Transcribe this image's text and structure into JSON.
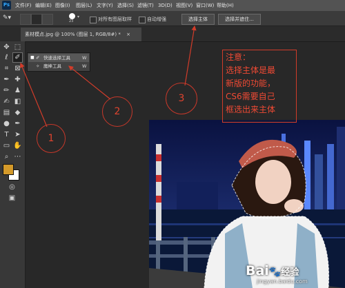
{
  "menu": {
    "logo": "Ps",
    "items": [
      "文件(F)",
      "编辑(E)",
      "图像(I)",
      "图层(L)",
      "文字(Y)",
      "选择(S)",
      "滤镜(T)",
      "3D(D)",
      "视图(V)",
      "窗口(W)",
      "帮助(H)"
    ]
  },
  "options": {
    "brush_size": "23",
    "sample_all_layers": "对所有图层取样",
    "auto_enhance": "自动增强",
    "select_subject": "选择主体",
    "select_and_mask": "选择并遮住..."
  },
  "document": {
    "tab_title": "素材模点.jpg @ 100% (图层 1, RGB/8#) *",
    "close": "×"
  },
  "flyout": {
    "items": [
      {
        "label": "快速选择工具",
        "shortcut": "W"
      },
      {
        "label": "魔棒工具",
        "shortcut": "W"
      }
    ]
  },
  "annotation": {
    "note_lines": [
      "注意：",
      "选择主体是最",
      "新版的功能，",
      "CS6需要自己",
      "框选出来主体"
    ],
    "markers": [
      "1",
      "2",
      "3"
    ]
  },
  "watermark": {
    "brand": "Bai",
    "brand_cn": "经验",
    "url": "jingyan.baidu.com"
  },
  "colors": {
    "annotation_red": "#d23c2a",
    "foreground_swatch": "#d49a2a",
    "background_swatch": "#ffffff"
  }
}
